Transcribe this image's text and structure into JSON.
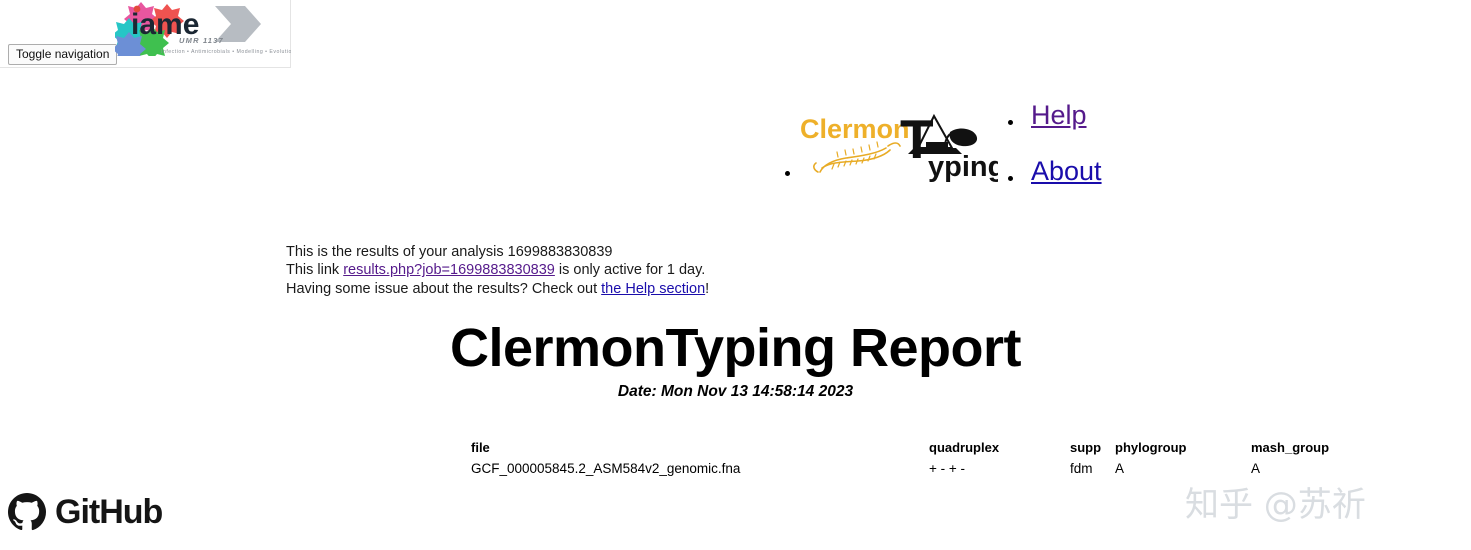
{
  "navbar": {
    "toggle_label": "Toggle navigation",
    "logo": {
      "name": "iame-logo",
      "wordmark": "iame",
      "unit": "UMR 1137",
      "tagline": "Infection • Antimicrobials • Modelling • Evolution",
      "colors": {
        "pink": "#e8569f",
        "red": "#ef5350",
        "teal": "#26c6c6",
        "green": "#3fc04f",
        "blue": "#6c8fd6",
        "gray_arrow": "#b7bcc2",
        "wordmark_dark": "#1b2733",
        "dot_red": "#e24a3c"
      }
    }
  },
  "header": {
    "brand": {
      "name": "clermontyping-logo",
      "part1": "Clermon",
      "part2": "T",
      "part3": "yping",
      "part1_color": "#eeb02a",
      "part2_color": "#111111",
      "bacterium_color": "#e8ab25"
    },
    "nav_items": [
      {
        "label": "Help",
        "color": "#551a8b"
      },
      {
        "label": "About",
        "color": "#1a0dab"
      }
    ]
  },
  "intro": {
    "line1_prefix": "This is the results of your analysis ",
    "job_id": "1699883830839",
    "line2_prefix": "This link ",
    "link_text": "results.php?job=1699883830839",
    "line2_suffix": " is only active for 1 day.",
    "line3_prefix": "Having some issue about the results? Check out ",
    "help_link_text": "the Help section",
    "line3_suffix": "!"
  },
  "report": {
    "title": "ClermonTyping Report",
    "date": "Date: Mon Nov 13 14:58:14 2023"
  },
  "table": {
    "headers": [
      "file",
      "quadruplex",
      "supp",
      "phylogroup",
      "mash_group"
    ],
    "rows": [
      {
        "file": "GCF_000005845.2_ASM584v2_genomic.fna",
        "quadruplex": "+ - + -",
        "supp": "fdm",
        "phylogroup": "A",
        "mash_group": "A"
      }
    ]
  },
  "footer": {
    "github_label": "GitHub",
    "github_icon": "github-octocat-icon"
  },
  "watermark": {
    "text": "知乎 @苏祈",
    "color": "#d9dde1"
  }
}
